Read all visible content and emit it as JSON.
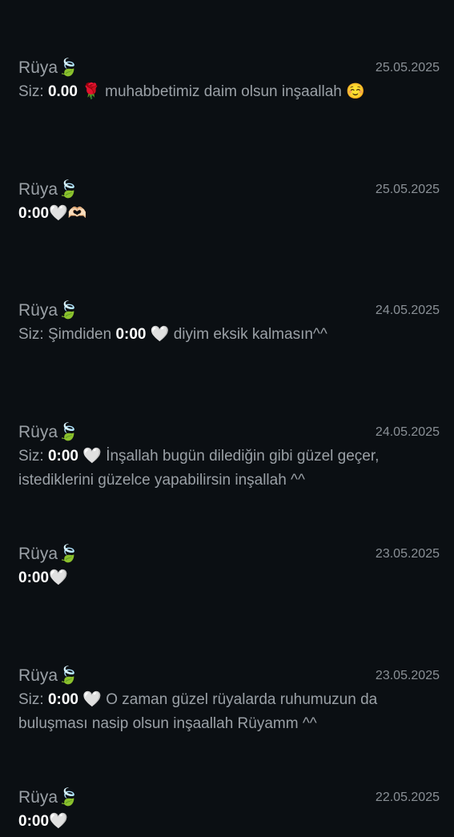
{
  "messages": [
    {
      "name": "Rüya🍃",
      "date": "25.05.2025",
      "prefix": "Siz: ",
      "time": "0.00",
      "text": " 🌹 muhabbetimiz daim olsun inşaallah ☺️"
    },
    {
      "name": "Rüya🍃",
      "date": "25.05.2025",
      "prefix": "",
      "time": "0:00",
      "text": "🤍🫶🏻"
    },
    {
      "name": "Rüya🍃",
      "date": "24.05.2025",
      "prefix": "Siz: Şimdiden ",
      "time": "0:00",
      "text": " 🤍 diyim eksik kalmasın^^"
    },
    {
      "name": "Rüya🍃",
      "date": "24.05.2025",
      "prefix": "Siz: ",
      "time": "0:00",
      "text": " 🤍 İnşallah bugün dilediğin gibi güzel geçer, istediklerini güzelce yapabilirsin inşallah ^^"
    },
    {
      "name": "Rüya🍃",
      "date": "23.05.2025",
      "prefix": "",
      "time": "0:00",
      "text": "🤍"
    },
    {
      "name": "Rüya🍃",
      "date": "23.05.2025",
      "prefix": "Siz: ",
      "time": "0:00",
      "text": " 🤍 O zaman güzel rüyalarda ruhumuzun da buluşması nasip olsun inşaallah Rüyamm ^^"
    },
    {
      "name": "Rüya🍃",
      "date": "22.05.2025",
      "prefix": "",
      "time": "0:00",
      "text": "🤍"
    }
  ]
}
